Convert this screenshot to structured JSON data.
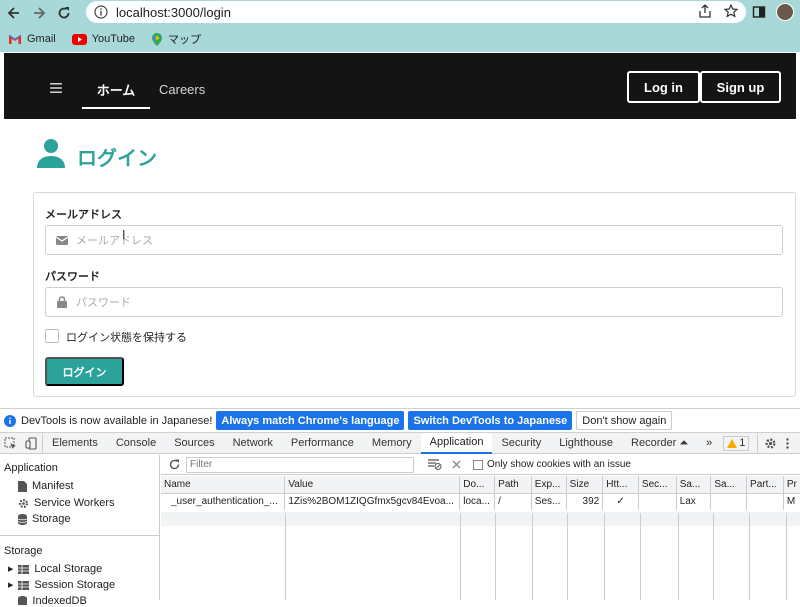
{
  "browser": {
    "url": "localhost:3000/login",
    "bookmarks": [
      {
        "label": "Gmail",
        "icon": "gmail-icon"
      },
      {
        "label": "YouTube",
        "icon": "youtube-icon"
      },
      {
        "label": "マップ",
        "icon": "maps-icon"
      }
    ]
  },
  "site_nav": {
    "home": "ホーム",
    "careers": "Careers",
    "login_button": "Log in",
    "signup_button": "Sign up"
  },
  "login_form": {
    "title": "ログイン",
    "email_label": "メールアドレス",
    "email_placeholder": "メールアドレス",
    "password_label": "パスワード",
    "password_placeholder": "パスワード",
    "remember_label": "ログイン状態を保持する",
    "submit_label": "ログイン"
  },
  "devtools": {
    "banner": {
      "message": "DevTools is now available in Japanese!",
      "match_button": "Always match Chrome's language",
      "switch_button": "Switch DevTools to Japanese",
      "dismiss_button": "Don't show again"
    },
    "tabs": [
      "Elements",
      "Console",
      "Sources",
      "Network",
      "Performance",
      "Memory",
      "Application",
      "Security",
      "Lighthouse",
      "Recorder ⏶"
    ],
    "active_tab": "Application",
    "more_tabs": "»",
    "issues_count": "1",
    "sidebar": {
      "application_header": "Application",
      "app_items": [
        "Manifest",
        "Service Workers",
        "Storage"
      ],
      "storage_header": "Storage",
      "storage_items": [
        "Local Storage",
        "Session Storage",
        "IndexedDB"
      ]
    },
    "toolbar": {
      "filter_placeholder": "Filter",
      "only_issues_label": "Only show cookies with an issue"
    },
    "cookie_table": {
      "headers": [
        "Name",
        "Value",
        "Do...",
        "Path",
        "Exp...",
        "Size",
        "Htt...",
        "Sec...",
        "Sa...",
        "Sa...",
        "Part...",
        "Pr"
      ],
      "rows": [
        [
          "_user_authentication_...",
          "1Zis%2BOM1ZIQGfmx5gcv84Evoa...",
          "loca...",
          "/",
          "Ses...",
          "392",
          "✓",
          "",
          "Lax",
          "",
          "",
          "M"
        ]
      ]
    }
  },
  "colors": {
    "accent": "#2ba39b",
    "nav_bg": "#141414",
    "browser_bar": "#a8d8d8",
    "devtools_blue": "#1a73e8"
  }
}
